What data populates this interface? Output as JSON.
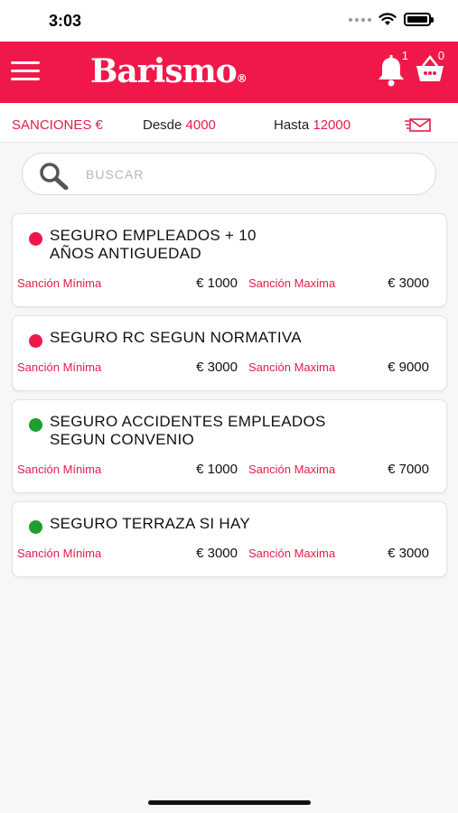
{
  "status_bar": {
    "time": "3:03"
  },
  "header": {
    "brand": "Barismo",
    "brand_mark": "®",
    "notifications_count": "1",
    "cart_count": "0",
    "brand_color": "#f0184a"
  },
  "filter": {
    "title": "SANCIONES €",
    "from_label": "Desde",
    "from_value": "4000",
    "to_label": "Hasta",
    "to_value": "12000"
  },
  "search": {
    "placeholder": "BUSCAR"
  },
  "items": [
    {
      "title_line1": "SEGURO EMPLEADOS + 10",
      "title_line2": "AÑOS ANTIGUEDAD",
      "status": "red",
      "min_label": "Sanción Mínima",
      "min_value": "€ 1000",
      "max_label": "Sanción Maxima",
      "max_value": "€ 3000"
    },
    {
      "title_line1": "SEGURO RC SEGUN NORMATIVA",
      "status": "red",
      "min_label": "Sanción Mínima",
      "min_value": "€ 3000",
      "max_label": "Sanción Maxima",
      "max_value": "€ 9000"
    },
    {
      "title_line1": "SEGURO ACCIDENTES EMPLEADOS",
      "title_line2": "SEGUN CONVENIO",
      "status": "green",
      "min_label": "Sanción Mínima",
      "min_value": "€ 1000",
      "max_label": "Sanción Maxima",
      "max_value": "€ 7000"
    },
    {
      "title_line1": "SEGURO TERRAZA SI HAY",
      "status": "green",
      "min_label": "Sanción Mínima",
      "min_value": "€ 3000",
      "max_label": "Sanción Maxima",
      "max_value": "€ 3000"
    }
  ]
}
